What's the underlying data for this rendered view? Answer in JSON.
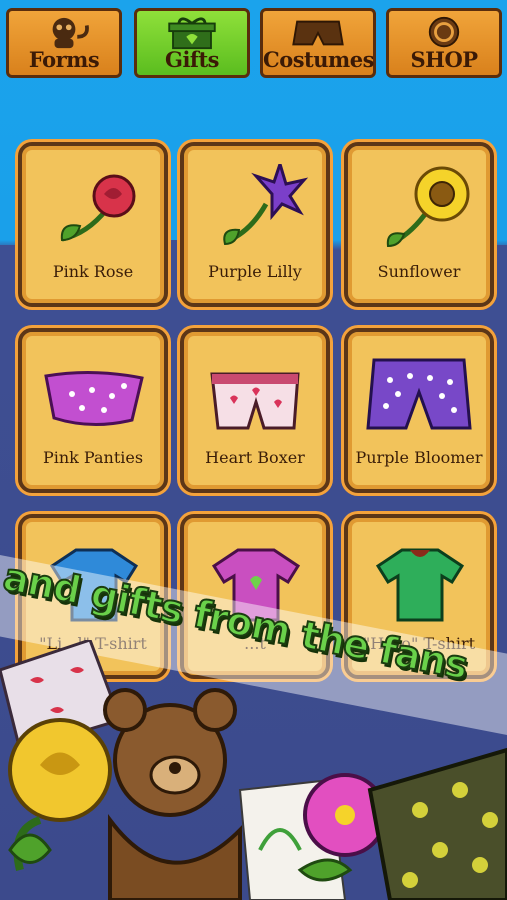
{
  "tabs": [
    {
      "label": "Forms",
      "active": false,
      "icon": "creature-icon"
    },
    {
      "label": "Gifts",
      "active": true,
      "icon": "gift-box-icon"
    },
    {
      "label": "Costumes",
      "active": false,
      "icon": "shorts-icon"
    },
    {
      "label": "SHOP",
      "active": false,
      "icon": "coin-icon"
    }
  ],
  "items": [
    {
      "name": "Pink Rose",
      "icon": "rose-icon"
    },
    {
      "name": "Purple Lilly",
      "icon": "lily-icon"
    },
    {
      "name": "Sunflower",
      "icon": "sunflower-icon"
    },
    {
      "name": "Pink Panties",
      "icon": "panties-icon"
    },
    {
      "name": "Heart Boxer",
      "icon": "boxer-icon"
    },
    {
      "name": "Purple Bloomer",
      "icon": "bloomer-icon"
    },
    {
      "name": "\"Li...l\" T-shirt",
      "icon": "blue-tshirt-icon"
    },
    {
      "name": "...t",
      "icon": "pink-tshirt-icon"
    },
    {
      "name": "\"Hero\" T-shirt",
      "icon": "green-tshirt-icon"
    }
  ],
  "banner": {
    "text": "and gifts from the fans"
  },
  "colors": {
    "sky": "#1ba3ec",
    "card": "#f2c35b",
    "active_tab": "#7ad232",
    "tab": "#e5922a"
  }
}
